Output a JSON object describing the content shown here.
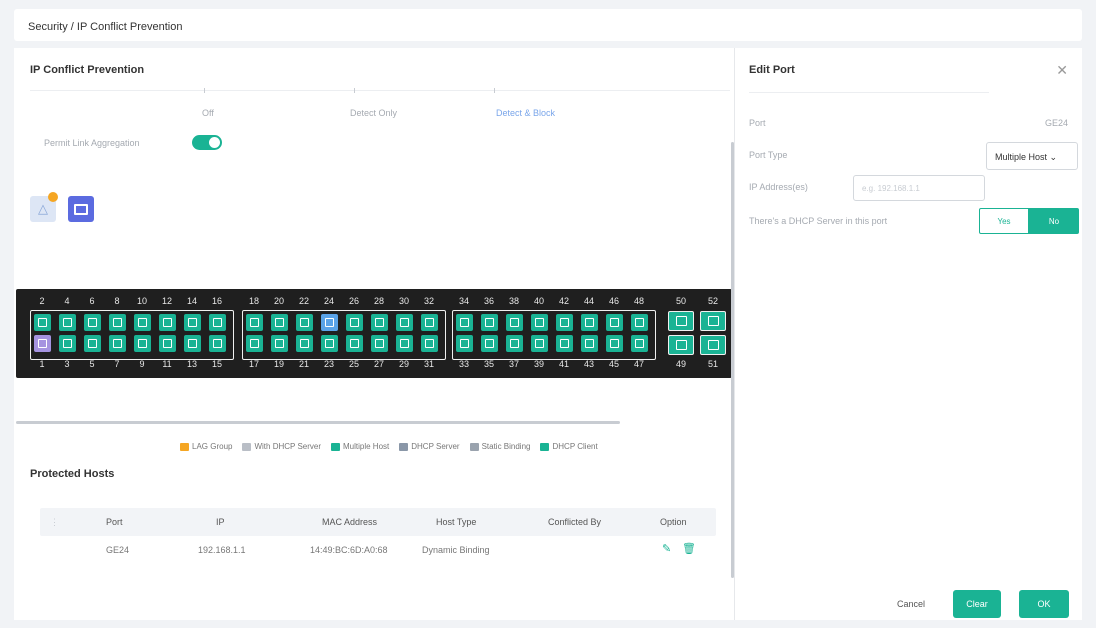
{
  "breadcrumb": "Security / IP Conflict Prevention",
  "left_panel": {
    "title": "IP Conflict Prevention",
    "modes": [
      "Off",
      "Detect Only",
      "Detect & Block"
    ],
    "permit_label": "Permit Link Aggregation",
    "permit_enabled": true
  },
  "switch": {
    "top_numbers": [
      "2",
      "4",
      "6",
      "8",
      "10",
      "12",
      "14",
      "16",
      "18",
      "20",
      "22",
      "24",
      "26",
      "28",
      "30",
      "32",
      "34",
      "36",
      "38",
      "40",
      "42",
      "44",
      "46",
      "48",
      "50",
      "52"
    ],
    "bottom_numbers": [
      "1",
      "3",
      "5",
      "7",
      "9",
      "11",
      "13",
      "15",
      "17",
      "19",
      "21",
      "23",
      "25",
      "27",
      "29",
      "31",
      "33",
      "35",
      "37",
      "39",
      "41",
      "43",
      "45",
      "47",
      "49",
      "51"
    ]
  },
  "legend": [
    "LAG Group",
    "With DHCP Server",
    "Multiple Host",
    "DHCP Server",
    "Static Binding",
    "DHCP Client"
  ],
  "protected_hosts": {
    "title": "Protected Hosts",
    "columns": [
      "Port",
      "IP",
      "MAC Address",
      "Host Type",
      "Conflicted By",
      "Option"
    ],
    "rows": [
      {
        "port": "GE24",
        "ip": "192.168.1.1",
        "mac": "14:49:BC:6D:A0:68",
        "host_type": "Dynamic Binding",
        "conflicted_by": ""
      }
    ]
  },
  "edit_port": {
    "title": "Edit Port",
    "port_label": "Port",
    "port_value": "GE24",
    "port_type_label": "Port Type",
    "port_type_value": "Multiple Host",
    "ip_label": "IP Address(es)",
    "ip_placeholder": "e.g. 192.168.1.1",
    "dhcp_label": "There's a DHCP Server in this port",
    "yes": "Yes",
    "no": "No",
    "cancel": "Cancel",
    "clear": "Clear",
    "ok": "OK"
  },
  "colors": {
    "accent": "#1ab394",
    "multi_host": "#5aa3e8",
    "warning": "#f5a623"
  }
}
